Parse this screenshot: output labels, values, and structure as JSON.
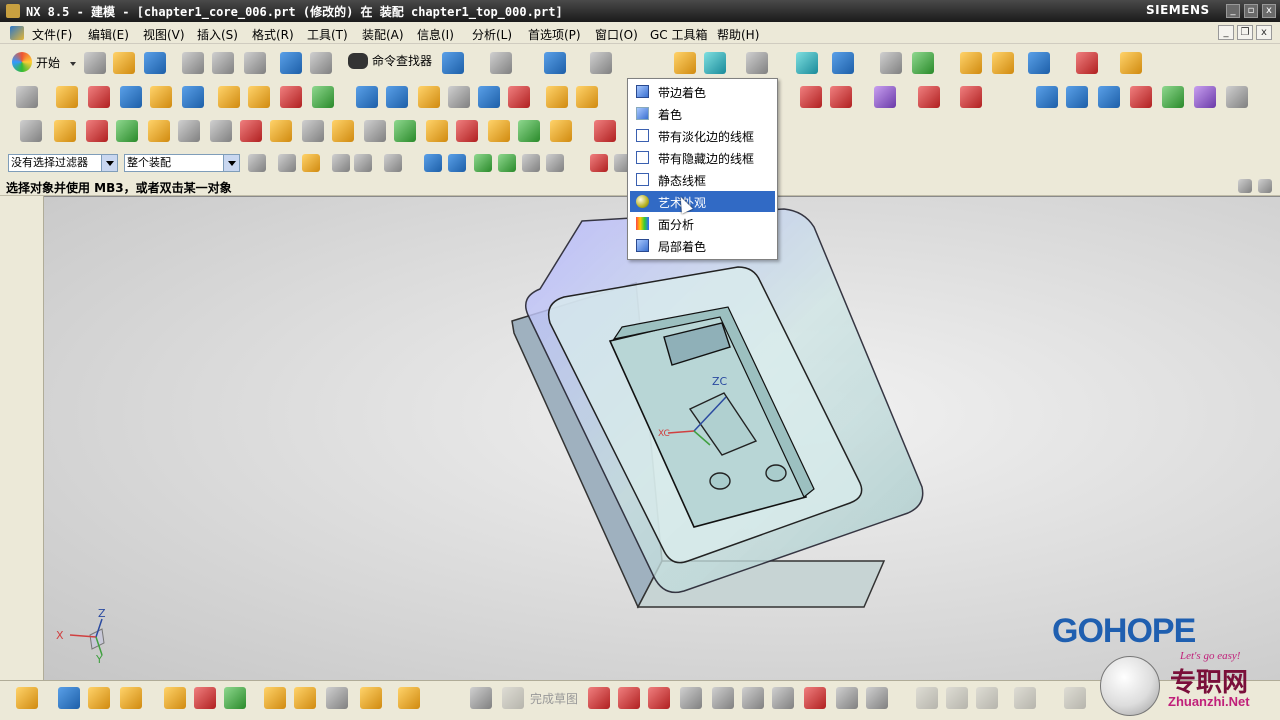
{
  "window": {
    "title": "NX 8.5 - 建模 - [chapter1_core_006.prt (修改的)  在 装配 chapter1_top_000.prt]",
    "brand": "SIEMENS",
    "min": "_",
    "max": "▫",
    "close": "x"
  },
  "menubar": {
    "items": [
      "文件(F)",
      "编辑(E)",
      "视图(V)",
      "插入(S)",
      "格式(R)",
      "工具(T)",
      "装配(A)",
      "信息(I)",
      "分析(L)",
      "首选项(P)",
      "窗口(O)",
      "GC 工具箱",
      "帮助(H)"
    ]
  },
  "toolbar": {
    "start_label": "开始",
    "command_finder": "命令查找器"
  },
  "filterbar": {
    "selection_filter": "没有选择过滤器",
    "scope": "整个装配"
  },
  "cue": "选择对象并使用 MB3，或者双击某一对象",
  "render_menu": {
    "items": [
      {
        "label": "带边着色",
        "icon": "shaded-with-edges-icon",
        "selected": false
      },
      {
        "label": "着色",
        "icon": "shaded-icon",
        "selected": false
      },
      {
        "label": "带有淡化边的线框",
        "icon": "wireframe-dim-edges-icon",
        "selected": false
      },
      {
        "label": "带有隐藏边的线框",
        "icon": "wireframe-hidden-edges-icon",
        "selected": false
      },
      {
        "label": "静态线框",
        "icon": "static-wireframe-icon",
        "selected": false
      },
      {
        "label": "艺术外观",
        "icon": "studio-appearance-icon",
        "selected": true
      },
      {
        "label": "面分析",
        "icon": "face-analysis-icon",
        "selected": false
      },
      {
        "label": "局部着色",
        "icon": "partial-shading-icon",
        "selected": false
      }
    ]
  },
  "viewport": {
    "axis_z": "ZC",
    "axis_x": "XC",
    "triad_x": "X",
    "triad_y": "Y",
    "triad_z": "Z"
  },
  "bottom": {
    "finish_sketch": "完成草图"
  },
  "watermark": {
    "brand": "GOHOPE",
    "slogan": "Let's go easy!",
    "site_cn": "专职网",
    "url": "Zhuanzhi.Net"
  }
}
